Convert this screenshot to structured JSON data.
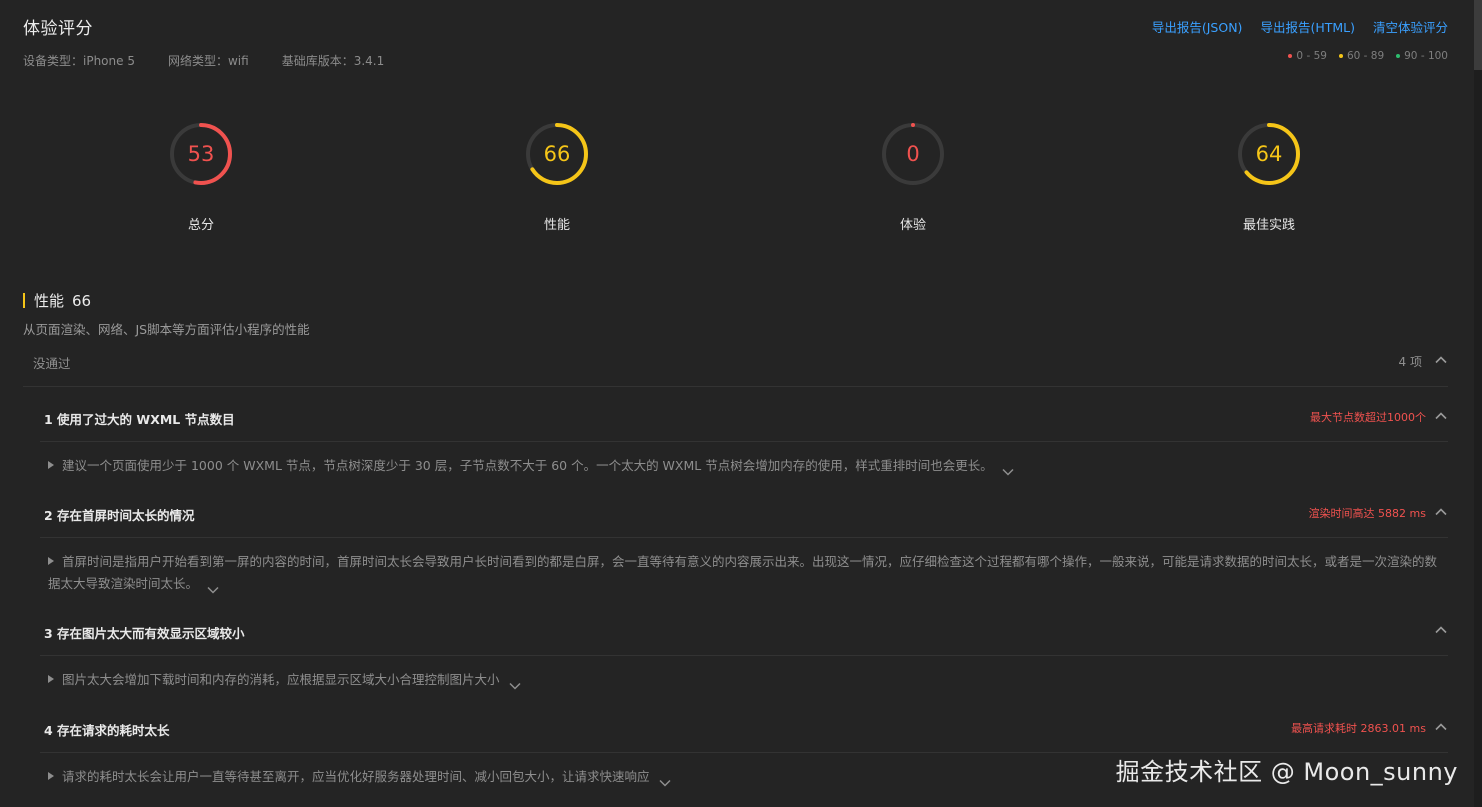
{
  "header": {
    "title": "体验评分",
    "device_type": "设备类型：iPhone 5",
    "network_type": "网络类型：wifi",
    "lib_version": "基础库版本：3.4.1",
    "actions": [
      "导出报告(JSON)",
      "导出报告(HTML)",
      "清空体验评分"
    ],
    "legend": [
      {
        "label": "0 - 59",
        "color": "#f0524f"
      },
      {
        "label": "60 - 89",
        "color": "#f5c518"
      },
      {
        "label": "90 - 100",
        "color": "#2dbd6e"
      }
    ]
  },
  "scores": [
    {
      "value": "53",
      "label": "总分",
      "fraction": 0.53,
      "color": "#f0524f"
    },
    {
      "value": "66",
      "label": "性能",
      "fraction": 0.66,
      "color": "#f5c518"
    },
    {
      "value": "0",
      "label": "体验",
      "fraction": 0.0,
      "color": "#f0524f"
    },
    {
      "value": "64",
      "label": "最佳实践",
      "fraction": 0.64,
      "color": "#f5c518"
    }
  ],
  "section": {
    "title": "性能",
    "score": "66",
    "description": "从页面渲染、网络、JS脚本等方面评估小程序的性能"
  },
  "group": {
    "label": "没通过",
    "count": "4 项"
  },
  "audits": [
    {
      "title": "1 使用了过大的 WXML 节点数目",
      "warning": "最大节点数超过1000个",
      "description": "建议一个页面使用少于 1000 个 WXML 节点，节点树深度少于 30 层，子节点数不大于 60 个。一个太大的 WXML 节点树会增加内存的使用，样式重排时间也会更长。"
    },
    {
      "title": "2 存在首屏时间太长的情况",
      "warning": "渲染时间高达 5882 ms",
      "description": "首屏时间是指用户开始看到第一屏的内容的时间，首屏时间太长会导致用户长时间看到的都是白屏，会一直等待有意义的内容展示出来。出现这一情况，应仔细检查这个过程都有哪个操作，一般来说，可能是请求数据的时间太长，或者是一次渲染的数据太大导致渲染时间太长。"
    },
    {
      "title": "3 存在图片太大而有效显示区域较小",
      "warning": "",
      "description": "图片太大会增加下载时间和内存的消耗，应根据显示区域大小合理控制图片大小"
    },
    {
      "title": "4 存在请求的耗时太长",
      "warning": "最高请求耗时 2863.01 ms",
      "description": "请求的耗时太长会让用户一直等待甚至离开，应当优化好服务器处理时间、减小回包大小，让请求快速响应"
    }
  ],
  "watermark": "掘金技术社区 @ Moon_sunny"
}
